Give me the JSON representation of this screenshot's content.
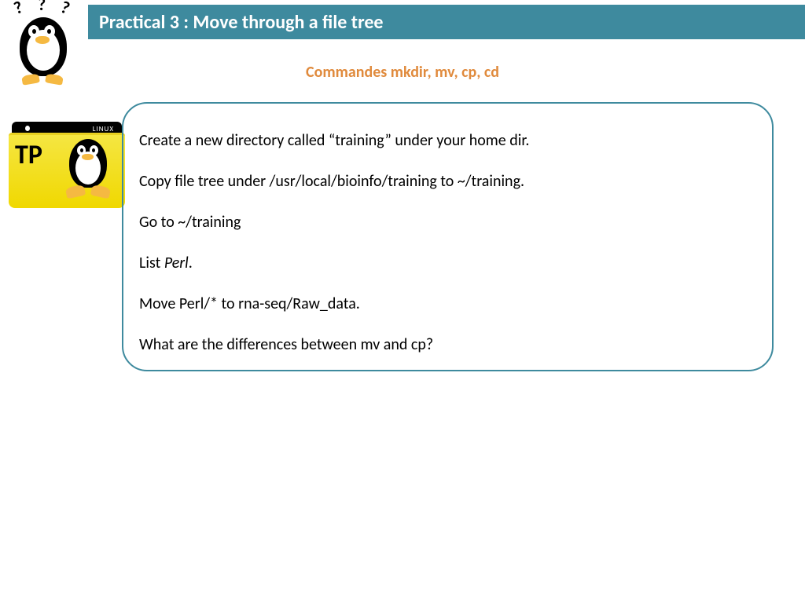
{
  "header": {
    "title": "Practical 3 : Move through a file tree"
  },
  "subtitle": "Commandes mkdir, mv, cp, cd",
  "folder": {
    "label": "TP",
    "tab_text": "LINUX"
  },
  "steps": {
    "s1": "Create a new directory called “training” under your home dir.",
    "s2": "Copy file tree under /usr/local/bioinfo/training to ~/training.",
    "s3": "Go to ~/training",
    "s4_prefix": "List  ",
    "s4_italic": "Perl",
    "s4_suffix": ".",
    "s5": "Move Perl/* to rna-seq/Raw_data.",
    "s6": "What are the differences between mv and cp?"
  }
}
